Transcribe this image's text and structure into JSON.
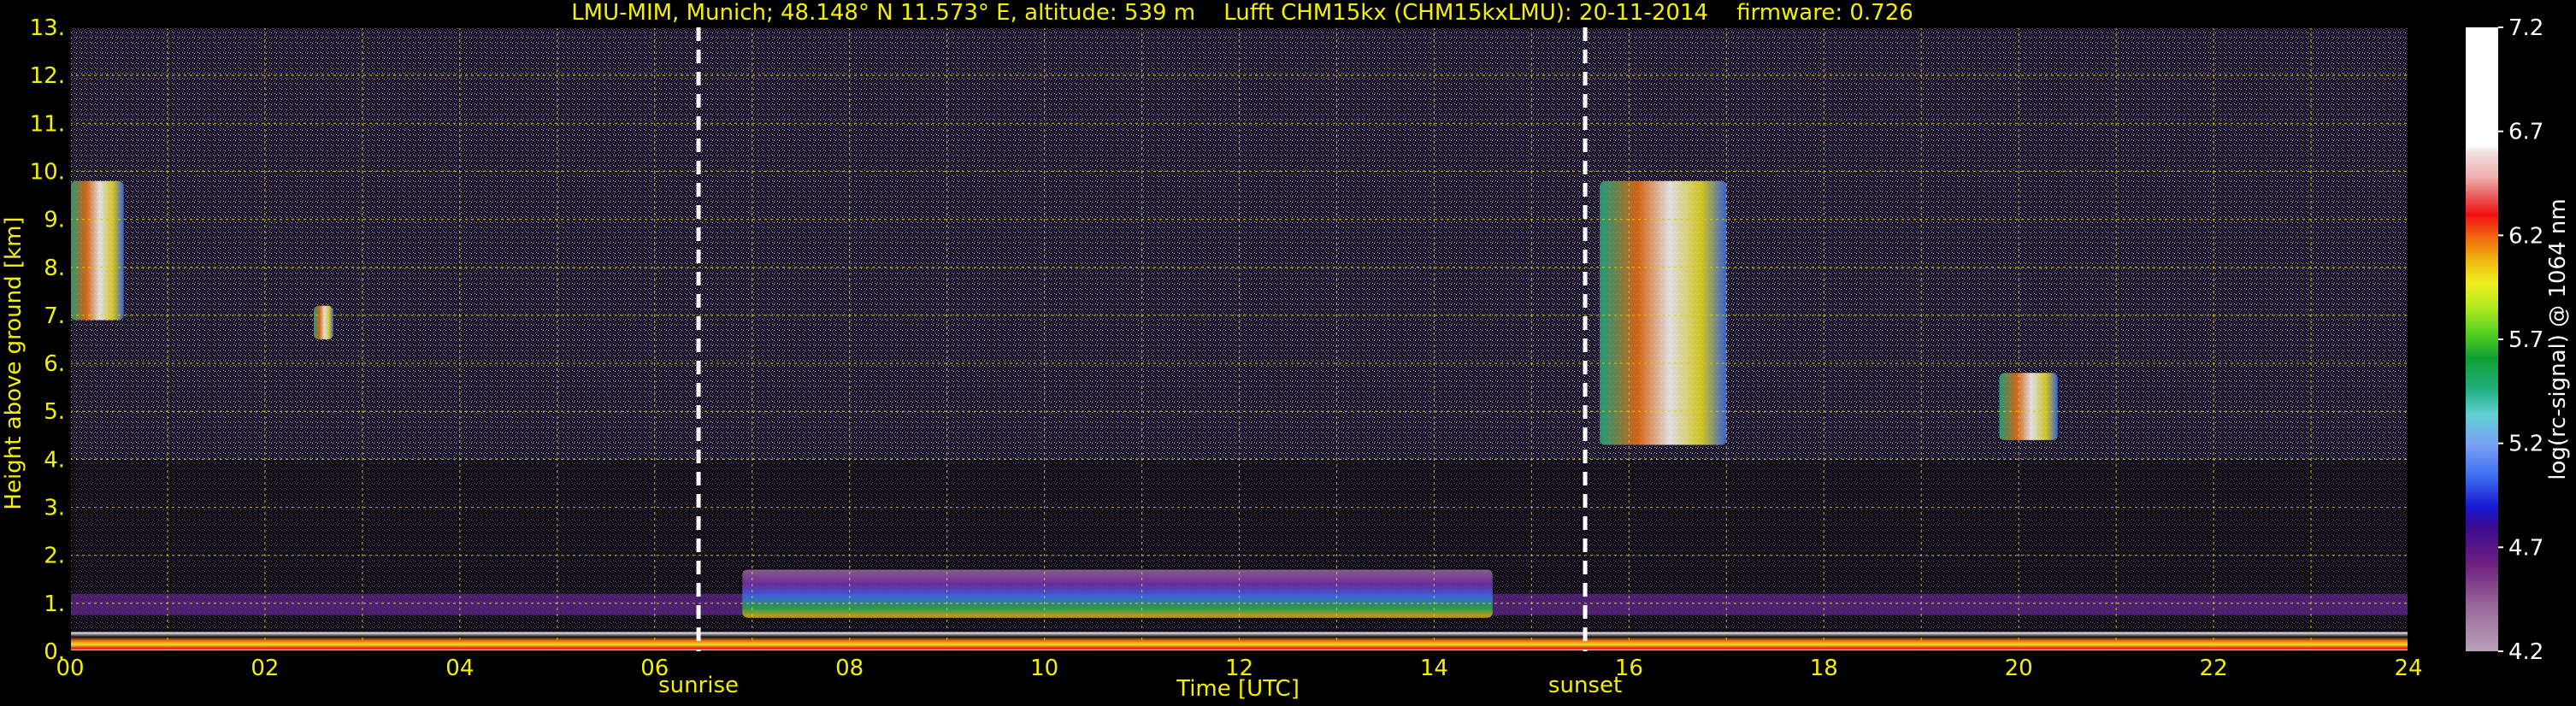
{
  "chart_data": {
    "type": "heatmap",
    "title": "LMU-MIM, Munich; 48.148° N 11.573° E, altitude: 539 m    Lufft CHM15kx (CHM15kxLMU): 20-11-2014    firmware: 0.726",
    "xlabel": "Time [UTC]",
    "ylabel": "Height above ground [km]",
    "xlim": [
      0,
      24
    ],
    "ylim": [
      0,
      13
    ],
    "x_ticks": [
      "00",
      "02",
      "04",
      "06",
      "08",
      "10",
      "12",
      "14",
      "16",
      "18",
      "20",
      "22",
      "24"
    ],
    "y_ticks": [
      "0.",
      "1.",
      "2.",
      "3.",
      "4.",
      "5.",
      "6.",
      "7.",
      "8.",
      "9.",
      "10.",
      "11.",
      "12.",
      "13."
    ],
    "grid": true,
    "markers": [
      {
        "label": "sunrise",
        "x": 6.45
      },
      {
        "label": "sunset",
        "x": 15.55
      }
    ],
    "colorbar": {
      "label": "log(rc-signal) @ 1064 nm",
      "ticks": [
        "4.2",
        "4.7",
        "5.2",
        "5.7",
        "6.2",
        "6.7",
        "7.2"
      ],
      "range": [
        4.2,
        7.2
      ]
    },
    "features": [
      {
        "name": "boundary_layer",
        "x_start": 0,
        "x_end": 24,
        "y_low": 0.0,
        "y_high": 0.4
      },
      {
        "name": "residual_layer",
        "x_start": 6.9,
        "x_end": 14.6,
        "y_low": 0.7,
        "y_high": 1.7
      },
      {
        "name": "cirrus_early",
        "x_start": 0.0,
        "x_end": 0.55,
        "y_low": 6.9,
        "y_high": 9.8
      },
      {
        "name": "cirrus_small",
        "x_start": 2.5,
        "x_end": 2.7,
        "y_low": 6.5,
        "y_high": 7.2
      },
      {
        "name": "cloud_evening",
        "x_start": 15.7,
        "x_end": 17.0,
        "y_low": 4.3,
        "y_high": 9.8
      },
      {
        "name": "cloud_late",
        "x_start": 19.8,
        "x_end": 20.4,
        "y_low": 4.4,
        "y_high": 5.8
      }
    ]
  }
}
